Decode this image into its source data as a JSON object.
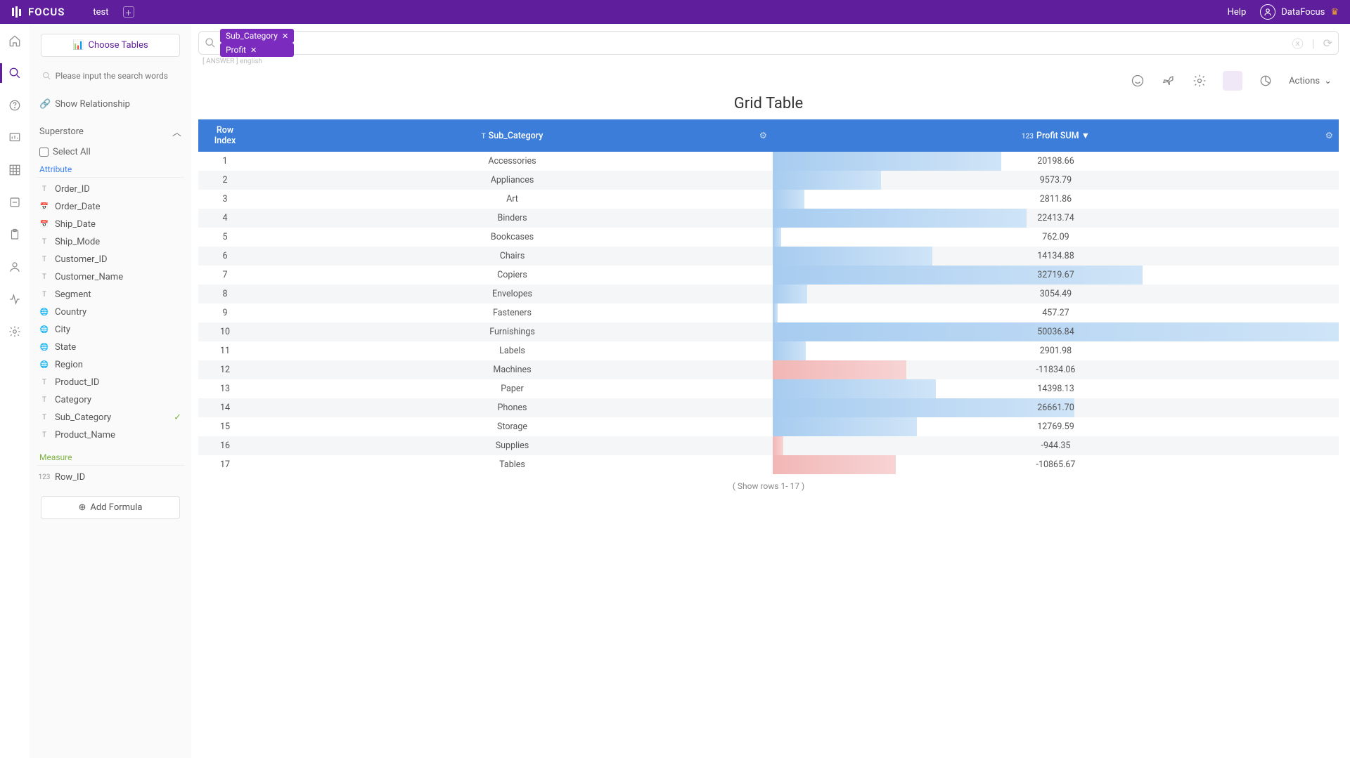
{
  "header": {
    "brand": "FOCUS",
    "tab": "test",
    "help": "Help",
    "user": "DataFocus"
  },
  "sidebar": {
    "choose_tables": "Choose Tables",
    "search_placeholder": "Please input the search words",
    "show_relationship": "Show Relationship",
    "datasource": "Superstore",
    "select_all": "Select All",
    "attribute_label": "Attribute",
    "measure_label": "Measure",
    "attributes": [
      {
        "icon": "T",
        "name": "Order_ID"
      },
      {
        "icon": "cal",
        "name": "Order_Date"
      },
      {
        "icon": "cal",
        "name": "Ship_Date"
      },
      {
        "icon": "T",
        "name": "Ship_Mode"
      },
      {
        "icon": "T",
        "name": "Customer_ID"
      },
      {
        "icon": "T",
        "name": "Customer_Name"
      },
      {
        "icon": "T",
        "name": "Segment"
      },
      {
        "icon": "globe",
        "name": "Country"
      },
      {
        "icon": "globe",
        "name": "City"
      },
      {
        "icon": "globe",
        "name": "State"
      },
      {
        "icon": "globe",
        "name": "Region"
      },
      {
        "icon": "T",
        "name": "Product_ID"
      },
      {
        "icon": "T",
        "name": "Category"
      },
      {
        "icon": "T",
        "name": "Sub_Category",
        "selected": true
      },
      {
        "icon": "T",
        "name": "Product_Name"
      }
    ],
    "measures": [
      {
        "icon": "123",
        "name": "Row_ID"
      }
    ],
    "add_formula": "Add Formula"
  },
  "query": {
    "pills": [
      "Sub_Category",
      "Profit"
    ],
    "crumb_left": "ANSWER",
    "crumb_right": "english"
  },
  "toolbar": {
    "actions": "Actions"
  },
  "table": {
    "title": "Grid Table",
    "col_index": "Row Index",
    "col_cat": "Sub_Category",
    "col_val": "Profit SUM",
    "footer": "( Show rows 1- 17 )"
  },
  "chart_data": {
    "type": "table",
    "columns": [
      "Row Index",
      "Sub_Category",
      "Profit SUM"
    ],
    "max_abs": 50037,
    "rows": [
      {
        "i": 1,
        "cat": "Accessories",
        "val": 20198.66
      },
      {
        "i": 2,
        "cat": "Appliances",
        "val": 9573.79
      },
      {
        "i": 3,
        "cat": "Art",
        "val": 2811.86
      },
      {
        "i": 4,
        "cat": "Binders",
        "val": 22413.74
      },
      {
        "i": 5,
        "cat": "Bookcases",
        "val": 762.09
      },
      {
        "i": 6,
        "cat": "Chairs",
        "val": 14134.88
      },
      {
        "i": 7,
        "cat": "Copiers",
        "val": 32719.67
      },
      {
        "i": 8,
        "cat": "Envelopes",
        "val": 3054.49
      },
      {
        "i": 9,
        "cat": "Fasteners",
        "val": 457.27
      },
      {
        "i": 10,
        "cat": "Furnishings",
        "val": 50036.84
      },
      {
        "i": 11,
        "cat": "Labels",
        "val": 2901.98
      },
      {
        "i": 12,
        "cat": "Machines",
        "val": -11834.06
      },
      {
        "i": 13,
        "cat": "Paper",
        "val": 14398.13
      },
      {
        "i": 14,
        "cat": "Phones",
        "val": 26661.7
      },
      {
        "i": 15,
        "cat": "Storage",
        "val": 12769.59
      },
      {
        "i": 16,
        "cat": "Supplies",
        "val": -944.35
      },
      {
        "i": 17,
        "cat": "Tables",
        "val": -10865.67
      }
    ]
  }
}
